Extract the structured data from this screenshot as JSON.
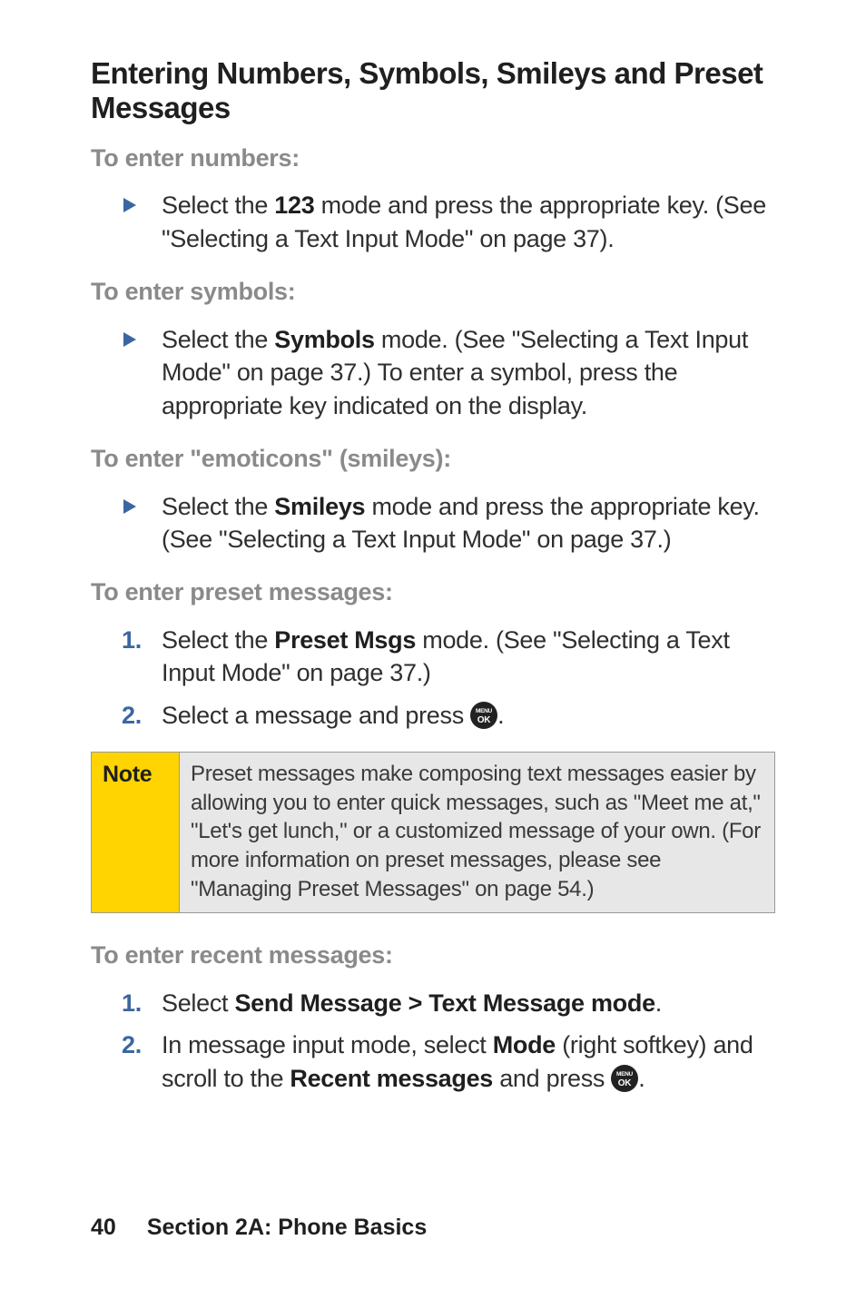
{
  "heading": "Entering Numbers, Symbols, Smileys and Preset Messages",
  "sections": {
    "numbers": {
      "lead": "To enter numbers:",
      "item_prefix": "Select the ",
      "item_bold": "123",
      "item_suffix": " mode and press the appropriate key. (See \"Selecting a Text Input Mode\" on page 37)."
    },
    "symbols": {
      "lead": "To enter symbols:",
      "item_prefix": "Select the ",
      "item_bold": "Symbols",
      "item_suffix": " mode. (See \"Selecting a Text Input Mode\" on page 37.) To enter a symbol, press the appropriate key indicated on the display."
    },
    "emoticons": {
      "lead": "To enter \"emoticons\" (smileys):",
      "item_prefix": "Select the ",
      "item_bold": "Smileys",
      "item_suffix": " mode and press the appropriate key. (See \"Selecting a Text Input Mode\" on page 37.)"
    },
    "preset": {
      "lead": "To enter preset messages:",
      "step1_prefix": "Select the ",
      "step1_bold": "Preset Msgs",
      "step1_suffix": " mode. (See \"Selecting a Text Input Mode\"  on page 37.)",
      "step2_prefix": "Select a message and press ",
      "step2_suffix": "."
    },
    "note": {
      "label": "Note",
      "body": "Preset messages make composing text messages easier by allowing you to enter quick messages, such as \"Meet me at,\" \"Let's get lunch,\" or a customized message of your own. (For more information on preset messages, please see \"Managing Preset Messages\" on page 54.)"
    },
    "recent": {
      "lead": "To enter recent messages:",
      "step1_prefix": "Select ",
      "step1_bold": "Send Message > Text Message mode",
      "step1_suffix": ".",
      "step2_prefix": "In message input mode, select ",
      "step2_bold1": "Mode",
      "step2_mid": " (right softkey) and scroll to the ",
      "step2_bold2": "Recent messages",
      "step2_after": " and press ",
      "step2_suffix": "."
    }
  },
  "footer": {
    "page": "40",
    "section": "Section 2A: Phone Basics"
  },
  "icons": {
    "menu_ok_top": "MENU",
    "menu_ok_bottom": "OK"
  }
}
